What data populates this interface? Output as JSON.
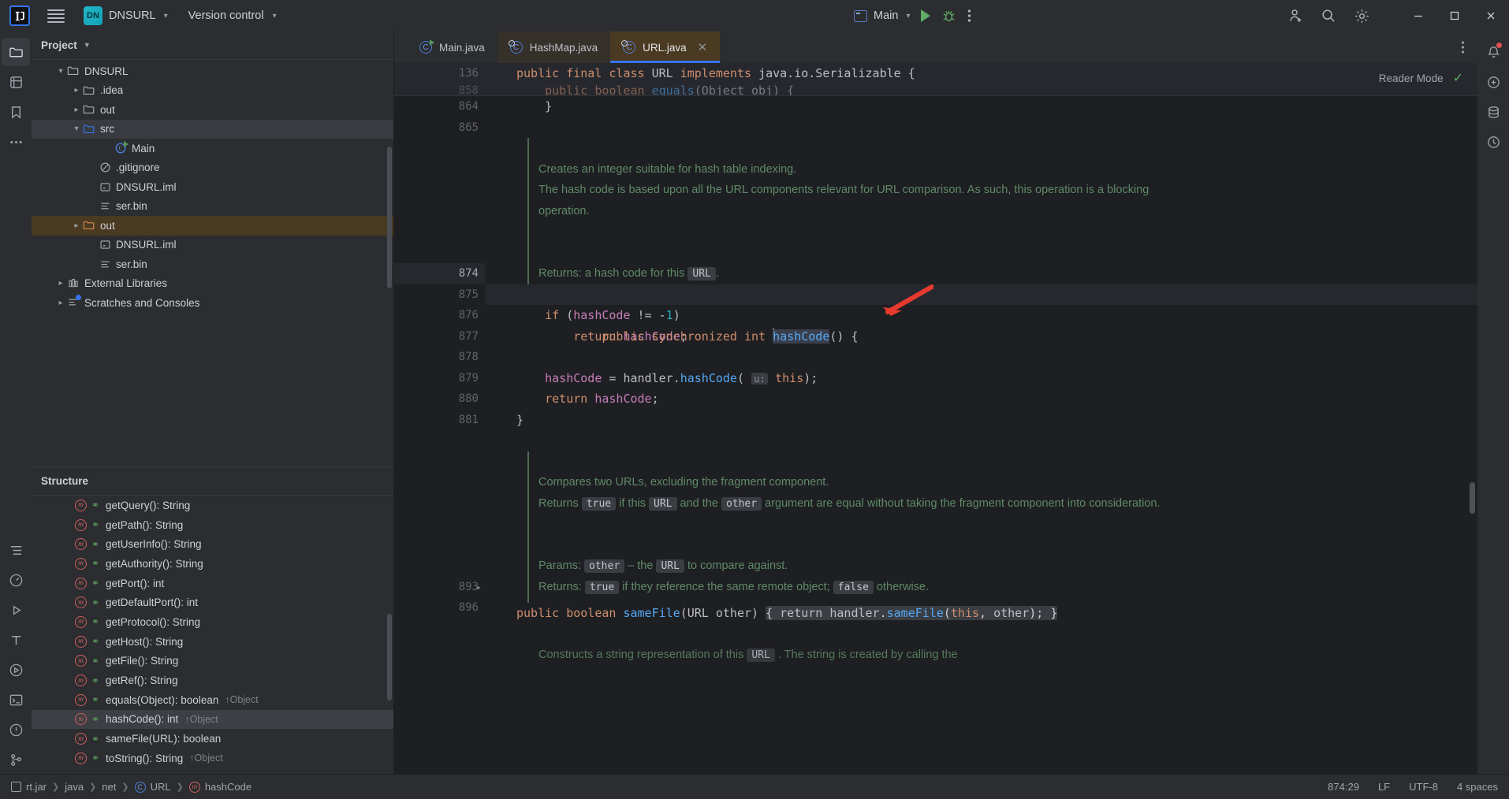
{
  "titlebar": {
    "logo": "IJ",
    "menu_icon": "hamburger-icon",
    "project_badge": "DN",
    "project_name": "DNSURL",
    "vcs_label": "Version control",
    "run_config": "Main",
    "run_icon": "run-icon",
    "debug_icon": "debug-icon",
    "more_icon": "more-vertical-icon",
    "account_icon": "add-user-icon",
    "search_icon": "search-icon",
    "settings_icon": "gear-icon",
    "minimize": "—",
    "maximize": "☐",
    "close": "✕"
  },
  "left_rail": [
    {
      "name": "project-tool-icon",
      "glyph": "folder",
      "active": true
    },
    {
      "name": "commit-tool-icon",
      "glyph": "commit",
      "active": false
    },
    {
      "name": "bookmarks-tool-icon",
      "glyph": "bookmark",
      "active": false
    },
    {
      "name": "more-tools-icon",
      "glyph": "ellipsis",
      "active": false
    },
    {
      "name": "structure-tool-icon",
      "glyph": "structure",
      "active": false
    },
    {
      "name": "profiler-tool-icon",
      "glyph": "gauge",
      "active": false
    },
    {
      "name": "run-tool-icon",
      "glyph": "play",
      "active": false
    },
    {
      "name": "todo-tool-icon",
      "glyph": "t",
      "active": false
    },
    {
      "name": "services-tool-icon",
      "glyph": "play-circle",
      "active": false
    },
    {
      "name": "terminal-tool-icon",
      "glyph": "terminal",
      "active": false
    },
    {
      "name": "problems-tool-icon",
      "glyph": "warning",
      "active": false
    },
    {
      "name": "git-tool-icon",
      "glyph": "git",
      "active": false
    }
  ],
  "right_rail": [
    {
      "name": "notifications-icon",
      "glyph": "bell",
      "badge": true
    },
    {
      "name": "ai-assistant-icon",
      "glyph": "ai"
    },
    {
      "name": "database-icon",
      "glyph": "db"
    },
    {
      "name": "history-icon",
      "glyph": "history"
    }
  ],
  "project_panel": {
    "title": "Project",
    "tree": [
      {
        "label": "DNSURL",
        "indent": 1,
        "arrow": "down",
        "icon": "folder",
        "state": "normal"
      },
      {
        "label": ".idea",
        "indent": 2,
        "arrow": "right",
        "icon": "folder",
        "state": "normal"
      },
      {
        "label": "out",
        "indent": 2,
        "arrow": "right",
        "icon": "folder",
        "state": "normal"
      },
      {
        "label": "src",
        "indent": 2,
        "arrow": "down",
        "icon": "folder-src",
        "state": "selected"
      },
      {
        "label": "Main",
        "indent": 4,
        "arrow": "none",
        "icon": "class-run",
        "state": "normal"
      },
      {
        "label": ".gitignore",
        "indent": 3,
        "arrow": "none",
        "icon": "gitignore",
        "state": "normal"
      },
      {
        "label": "DNSURL.iml",
        "indent": 3,
        "arrow": "none",
        "icon": "iml",
        "state": "normal"
      },
      {
        "label": "ser.bin",
        "indent": 3,
        "arrow": "none",
        "icon": "bin",
        "state": "normal"
      },
      {
        "label": "out",
        "indent": 2,
        "arrow": "right",
        "icon": "folder-out",
        "state": "highlight-out"
      },
      {
        "label": "DNSURL.iml",
        "indent": 3,
        "arrow": "none",
        "icon": "iml",
        "state": "normal"
      },
      {
        "label": "ser.bin",
        "indent": 3,
        "arrow": "none",
        "icon": "bin",
        "state": "normal"
      },
      {
        "label": "External Libraries",
        "indent": 1,
        "arrow": "right",
        "icon": "library",
        "state": "normal"
      },
      {
        "label": "Scratches and Consoles",
        "indent": 1,
        "arrow": "right",
        "icon": "scratch",
        "state": "normal"
      }
    ]
  },
  "structure_panel": {
    "title": "Structure",
    "items": [
      {
        "label": "getQuery(): String",
        "override": "",
        "state": "normal"
      },
      {
        "label": "getPath(): String",
        "override": "",
        "state": "normal"
      },
      {
        "label": "getUserInfo(): String",
        "override": "",
        "state": "normal"
      },
      {
        "label": "getAuthority(): String",
        "override": "",
        "state": "normal"
      },
      {
        "label": "getPort(): int",
        "override": "",
        "state": "normal"
      },
      {
        "label": "getDefaultPort(): int",
        "override": "",
        "state": "normal"
      },
      {
        "label": "getProtocol(): String",
        "override": "",
        "state": "normal"
      },
      {
        "label": "getHost(): String",
        "override": "",
        "state": "normal"
      },
      {
        "label": "getFile(): String",
        "override": "",
        "state": "normal"
      },
      {
        "label": "getRef(): String",
        "override": "",
        "state": "normal"
      },
      {
        "label": "equals(Object): boolean",
        "override": "↑Object",
        "state": "normal"
      },
      {
        "label": "hashCode(): int",
        "override": "↑Object",
        "state": "selected"
      },
      {
        "label": "sameFile(URL): boolean",
        "override": "",
        "state": "normal"
      },
      {
        "label": "toString(): String",
        "override": "↑Object",
        "state": "normal"
      }
    ]
  },
  "editor": {
    "tabs": [
      {
        "label": "Main.java",
        "icon": "class-run-icon",
        "state": "normal",
        "closeable": false
      },
      {
        "label": "HashMap.java",
        "icon": "class-lib-icon",
        "state": "modified",
        "closeable": false
      },
      {
        "label": "URL.java",
        "icon": "class-lib-icon",
        "state": "active",
        "closeable": true
      }
    ],
    "more_tabs_icon": "more-vertical-icon",
    "reader_mode": "Reader Mode",
    "inspection_ok_icon": "check-icon",
    "sticky_lines": [
      {
        "num": "136",
        "text": "public final class URL implements java.io.Serializable {"
      },
      {
        "num": "858",
        "text": "public boolean equals(Object obj) {"
      }
    ],
    "lines": [
      {
        "num": "864",
        "kind": "code",
        "text": "    }"
      },
      {
        "num": "865",
        "kind": "code",
        "text": ""
      },
      {
        "num": "",
        "kind": "blank",
        "text": ""
      },
      {
        "num": "",
        "kind": "doc",
        "text": "Creates an integer suitable for hash table indexing."
      },
      {
        "num": "",
        "kind": "doc",
        "text": "The hash code is based upon all the URL components relevant for URL comparison. As such, this operation is a blocking operation."
      },
      {
        "num": "",
        "kind": "doc",
        "text": ""
      },
      {
        "num": "",
        "kind": "doc-returns",
        "text": "Returns: a hash code for this URL ."
      },
      {
        "num": "874",
        "kind": "code-current",
        "text": "public synchronized int hashCode() {",
        "gutter_icon": "override-icon"
      },
      {
        "num": "875",
        "kind": "code",
        "text": "    if (hashCode != -1)"
      },
      {
        "num": "876",
        "kind": "code",
        "text": "        return hashCode;"
      },
      {
        "num": "877",
        "kind": "code",
        "text": ""
      },
      {
        "num": "878",
        "kind": "code",
        "text": "    hashCode = handler.hashCode( u: this);"
      },
      {
        "num": "879",
        "kind": "code",
        "text": "    return hashCode;"
      },
      {
        "num": "880",
        "kind": "code",
        "text": "}"
      },
      {
        "num": "881",
        "kind": "code",
        "text": ""
      },
      {
        "num": "",
        "kind": "doc2",
        "text": "Compares two URLs, excluding the fragment component."
      },
      {
        "num": "893",
        "kind": "code-fold",
        "text": "public boolean sameFile(URL other) { return handler.sameFile(this, other); }"
      },
      {
        "num": "896",
        "kind": "code",
        "text": ""
      }
    ],
    "doc2_lines": [
      "Compares two URLs, excluding the fragment component.",
      "Returns true if this URL and the other argument are equal without taking the fragment component into consideration.",
      "Params: other – the URL to compare against.",
      "Returns: true if they reference the same remote object; false otherwise."
    ],
    "doc3_line": "Constructs a string representation of this URL . The string is created by calling the"
  },
  "status_bar": {
    "breadcrumbs": [
      {
        "label": "rt.jar",
        "icon": "jar-icon"
      },
      {
        "label": "java",
        "icon": ""
      },
      {
        "label": "net",
        "icon": ""
      },
      {
        "label": "URL",
        "icon": "class-icon"
      },
      {
        "label": "hashCode",
        "icon": "method-icon"
      }
    ],
    "caret_position": "874:29",
    "line_separator": "LF",
    "encoding": "UTF-8",
    "indent": "4 spaces"
  },
  "colors": {
    "accent_blue": "#3574f0",
    "tab_active_bg": "#4a3a22",
    "keyword": "#cf8e6d",
    "method": "#56a8f5",
    "field": "#c77dbb",
    "number": "#2aacb8",
    "javadoc": "#5f8a68",
    "arrow_annotation": "#e8392f"
  }
}
